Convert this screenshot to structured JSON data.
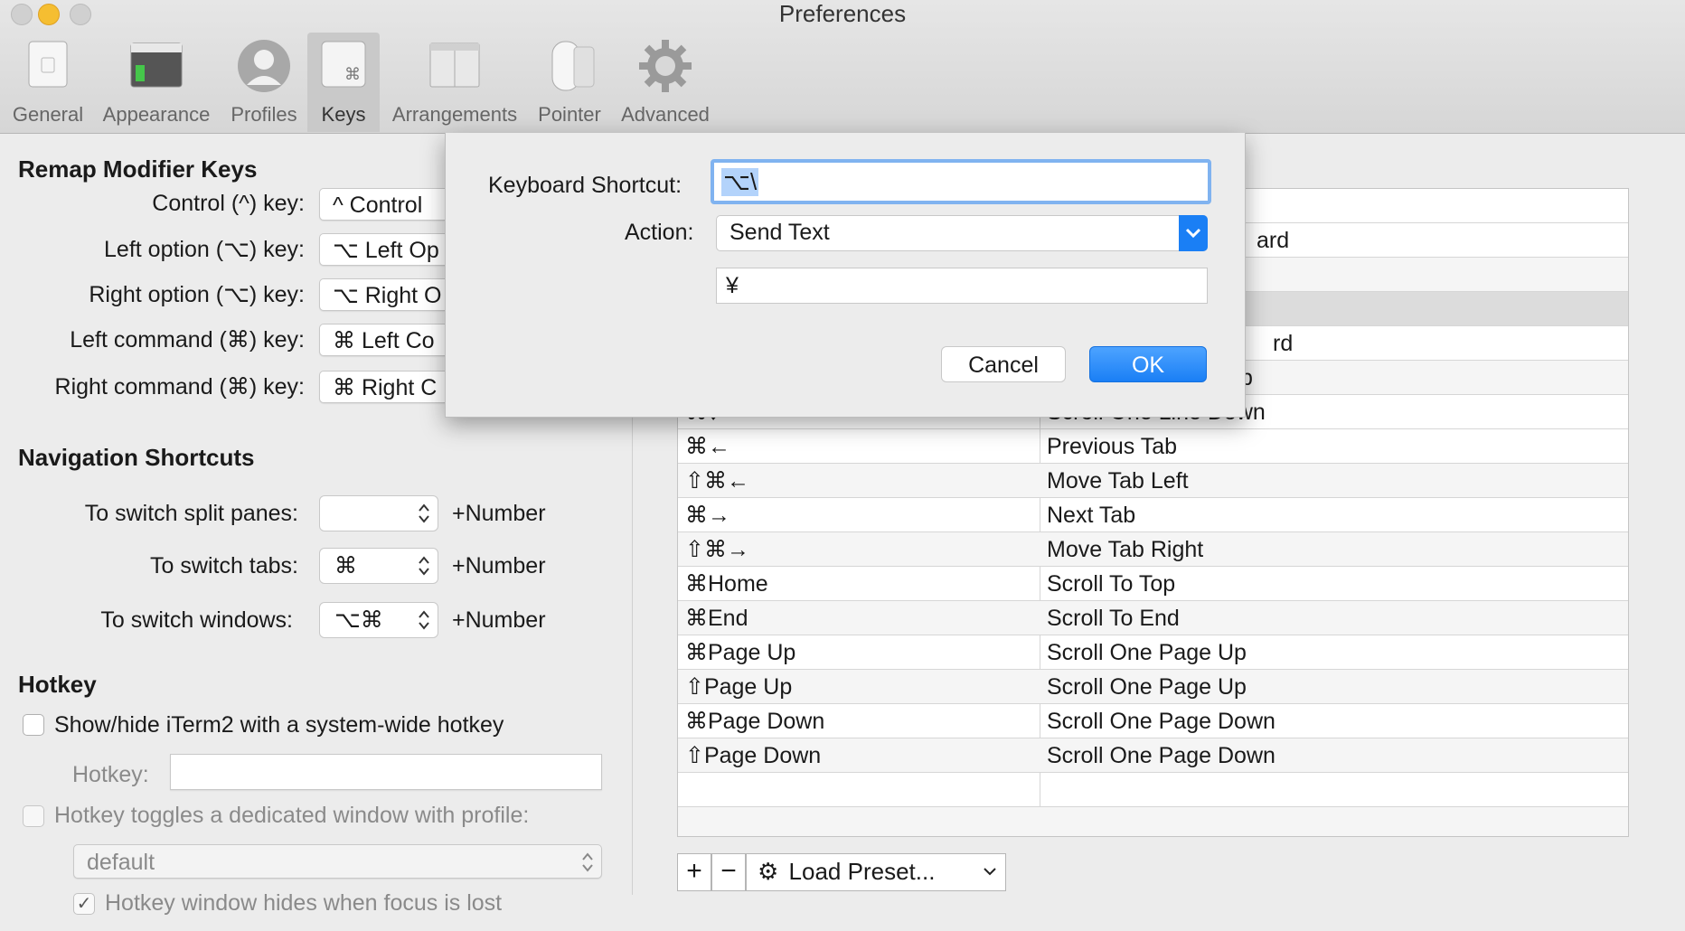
{
  "window": {
    "title": "Preferences"
  },
  "toolbar": {
    "items": [
      {
        "label": "General",
        "icon": "general-icon"
      },
      {
        "label": "Appearance",
        "icon": "appearance-icon"
      },
      {
        "label": "Profiles",
        "icon": "profiles-icon"
      },
      {
        "label": "Keys",
        "icon": "keys-icon",
        "selected": true
      },
      {
        "label": "Arrangements",
        "icon": "arrangements-icon"
      },
      {
        "label": "Pointer",
        "icon": "pointer-icon"
      },
      {
        "label": "Advanced",
        "icon": "advanced-gear-icon"
      }
    ]
  },
  "remap": {
    "heading": "Remap Modifier Keys",
    "rows": [
      {
        "label": "Control (^) key:",
        "value": "^ Control"
      },
      {
        "label": "Left option (⌥) key:",
        "value": "⌥ Left Op"
      },
      {
        "label": "Right option (⌥) key:",
        "value": "⌥ Right O"
      },
      {
        "label": "Left command (⌘) key:",
        "value": "⌘ Left Co"
      },
      {
        "label": "Right command (⌘) key:",
        "value": "⌘ Right C"
      }
    ]
  },
  "navigation": {
    "heading": "Navigation Shortcuts",
    "rows": [
      {
        "label": "To switch split panes:",
        "value": "",
        "suffix": "+Number"
      },
      {
        "label": "To switch tabs:",
        "value": "⌘",
        "suffix": "+Number"
      },
      {
        "label": "To switch windows:",
        "value": "⌥⌘",
        "suffix": "+Number"
      }
    ]
  },
  "hotkey": {
    "heading": "Hotkey",
    "show_hide_label": "Show/hide iTerm2 with a system-wide hotkey",
    "show_hide_checked": false,
    "hotkey_label": "Hotkey:",
    "hotkey_value": "",
    "dedicated_label": "Hotkey toggles a dedicated window with profile:",
    "dedicated_checked": false,
    "profile_value": "default",
    "hides_label": "Hotkey window hides when focus is lost",
    "hides_checked": true
  },
  "key_table": {
    "partial_visible": [
      "ard",
      "rd",
      "p",
      "Scroll One Line Down"
    ],
    "rows": [
      {
        "shortcut": "⌘←",
        "action": "Previous Tab"
      },
      {
        "shortcut": "⇧⌘←",
        "action": "Move Tab Left"
      },
      {
        "shortcut": "⌘→",
        "action": "Next Tab"
      },
      {
        "shortcut": "⇧⌘→",
        "action": "Move Tab Right"
      },
      {
        "shortcut": "⌘Home",
        "action": "Scroll To Top"
      },
      {
        "shortcut": "⌘End",
        "action": "Scroll To End"
      },
      {
        "shortcut": "⌘Page Up",
        "action": "Scroll One Page Up"
      },
      {
        "shortcut": "⇧Page Up",
        "action": "Scroll One Page Up"
      },
      {
        "shortcut": "⌘Page Down",
        "action": "Scroll One Page Down"
      },
      {
        "shortcut": "⇧Page Down",
        "action": "Scroll One Page Down"
      }
    ]
  },
  "table_controls": {
    "add": "+",
    "remove": "−",
    "preset_label": "Load Preset..."
  },
  "sheet": {
    "shortcut_label": "Keyboard Shortcut:",
    "shortcut_value": "⌥\\",
    "action_label": "Action:",
    "action_value": "Send Text",
    "text_value": "¥",
    "cancel_label": "Cancel",
    "ok_label": "OK"
  },
  "colors": {
    "accent": "#1a7ff5",
    "selection": "#b3d3fb"
  }
}
